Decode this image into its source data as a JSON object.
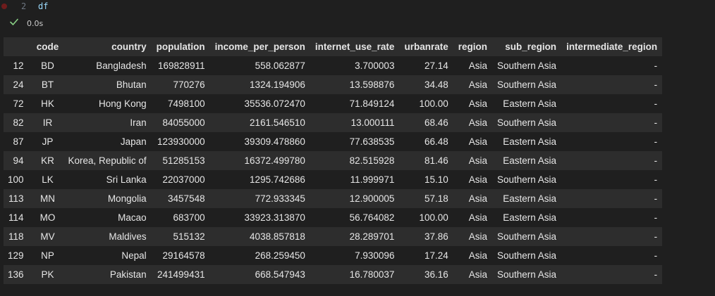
{
  "cell": {
    "line_number": "2",
    "code": "df",
    "exec_time": "0.0s"
  },
  "table": {
    "columns": [
      "",
      "code",
      "country",
      "population",
      "income_per_person",
      "internet_use_rate",
      "urbanrate",
      "region",
      "sub_region",
      "intermediate_region"
    ],
    "rows": [
      [
        "12",
        "BD",
        "Bangladesh",
        "169828911",
        "558.062877",
        "3.700003",
        "27.14",
        "Asia",
        "Southern Asia",
        "-"
      ],
      [
        "24",
        "BT",
        "Bhutan",
        "770276",
        "1324.194906",
        "13.598876",
        "34.48",
        "Asia",
        "Southern Asia",
        "-"
      ],
      [
        "72",
        "HK",
        "Hong Kong",
        "7498100",
        "35536.072470",
        "71.849124",
        "100.00",
        "Asia",
        "Eastern Asia",
        "-"
      ],
      [
        "82",
        "IR",
        "Iran",
        "84055000",
        "2161.546510",
        "13.000111",
        "68.46",
        "Asia",
        "Southern Asia",
        "-"
      ],
      [
        "87",
        "JP",
        "Japan",
        "123930000",
        "39309.478860",
        "77.638535",
        "66.48",
        "Asia",
        "Eastern Asia",
        "-"
      ],
      [
        "94",
        "KR",
        "Korea, Republic of",
        "51285153",
        "16372.499780",
        "82.515928",
        "81.46",
        "Asia",
        "Eastern Asia",
        "-"
      ],
      [
        "100",
        "LK",
        "Sri Lanka",
        "22037000",
        "1295.742686",
        "11.999971",
        "15.10",
        "Asia",
        "Southern Asia",
        "-"
      ],
      [
        "113",
        "MN",
        "Mongolia",
        "3457548",
        "772.933345",
        "12.900005",
        "57.18",
        "Asia",
        "Eastern Asia",
        "-"
      ],
      [
        "114",
        "MO",
        "Macao",
        "683700",
        "33923.313870",
        "56.764082",
        "100.00",
        "Asia",
        "Eastern Asia",
        "-"
      ],
      [
        "118",
        "MV",
        "Maldives",
        "515132",
        "4038.857818",
        "28.289701",
        "37.86",
        "Asia",
        "Southern Asia",
        "-"
      ],
      [
        "129",
        "NP",
        "Nepal",
        "29164578",
        "268.259450",
        "7.930096",
        "17.24",
        "Asia",
        "Southern Asia",
        "-"
      ],
      [
        "136",
        "PK",
        "Pakistan",
        "241499431",
        "668.547943",
        "16.780037",
        "36.16",
        "Asia",
        "Southern Asia",
        "-"
      ]
    ]
  }
}
